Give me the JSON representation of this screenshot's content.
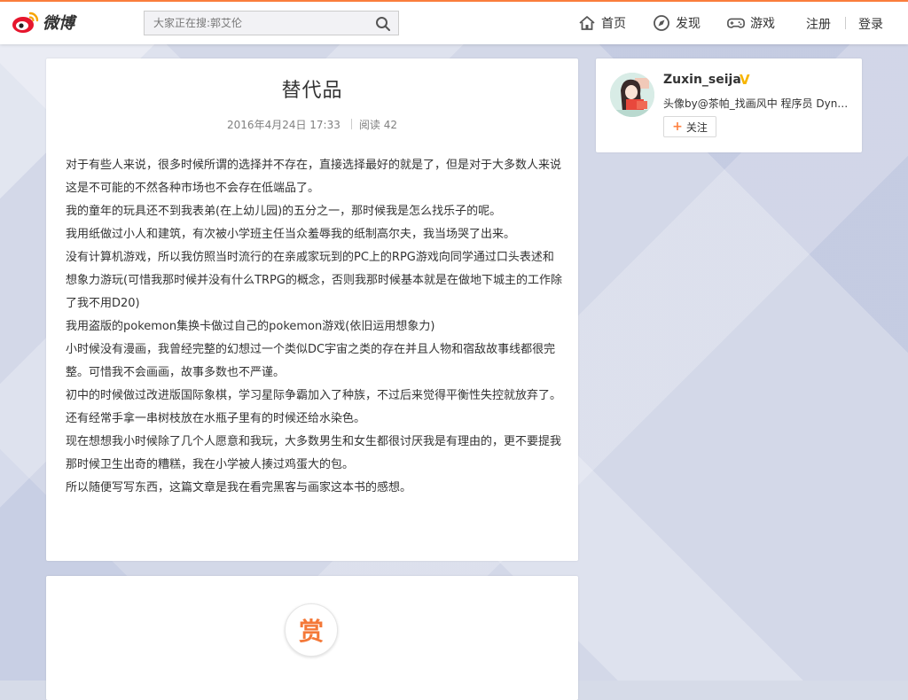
{
  "header": {
    "logo_text": "微博",
    "search": {
      "placeholder": "大家正在搜:郭艾伦"
    },
    "nav": [
      {
        "label": "首页",
        "icon": "home-icon"
      },
      {
        "label": "发现",
        "icon": "compass-icon"
      },
      {
        "label": "游戏",
        "icon": "gamepad-icon"
      }
    ],
    "register_label": "注册",
    "login_label": "登录",
    "accent_color": "#fa7d3c"
  },
  "article": {
    "title": "替代品",
    "date": "2016年4月24日 17:33",
    "reads": "阅读 42",
    "paragraphs": [
      " 对于有些人来说，很多时候所谓的选择并不存在，直接选择最好的就是了，但是对于大多数人来说这是不可能的不然各种市场也不会存在低端品了。",
      "  我的童年的玩具还不到我表弟(在上幼儿园)的五分之一，那时候我是怎么找乐子的呢。",
      "  我用纸做过小人和建筑，有次被小学班主任当众羞辱我的纸制高尔夫，我当场哭了出来。",
      "  没有计算机游戏，所以我仿照当时流行的在亲戚家玩到的PC上的RPG游戏向同学通过口头表述和想象力游玩(可惜我那时候并没有什么TRPG的概念，否则我那时候基本就是在做地下城主的工作除了我不用D20)",
      "  我用盗版的pokemon集换卡做过自己的pokemon游戏(依旧运用想象力)",
      "  小时候没有漫画，我曾经完整的幻想过一个类似DC宇宙之类的存在并且人物和宿敌故事线都很完整。可惜我不会画画，故事多数也不严谨。",
      "  初中的时候做过改进版国际象棋，学习星际争霸加入了种族，不过后来觉得平衡性失控就放弃了。",
      " 还有经常手拿一串树枝放在水瓶子里有的时候还给水染色。",
      "  现在想想我小时候除了几个人愿意和我玩，大多数男生和女生都很讨厌我是有理由的，更不要提我那时候卫生出奇的糟糕，我在小学被人揍过鸡蛋大的包。",
      "  所以随便写写东西，这篇文章是我在看完黑客与画家这本书的感想。"
    ]
  },
  "reward": {
    "label": "赏",
    "color": "#f47838"
  },
  "profile": {
    "name": "Zuxin_seija",
    "verified_mark": "V",
    "description": "头像by@茶帕_找画风中 程序员 Dyna...",
    "follow_label": "关注"
  }
}
